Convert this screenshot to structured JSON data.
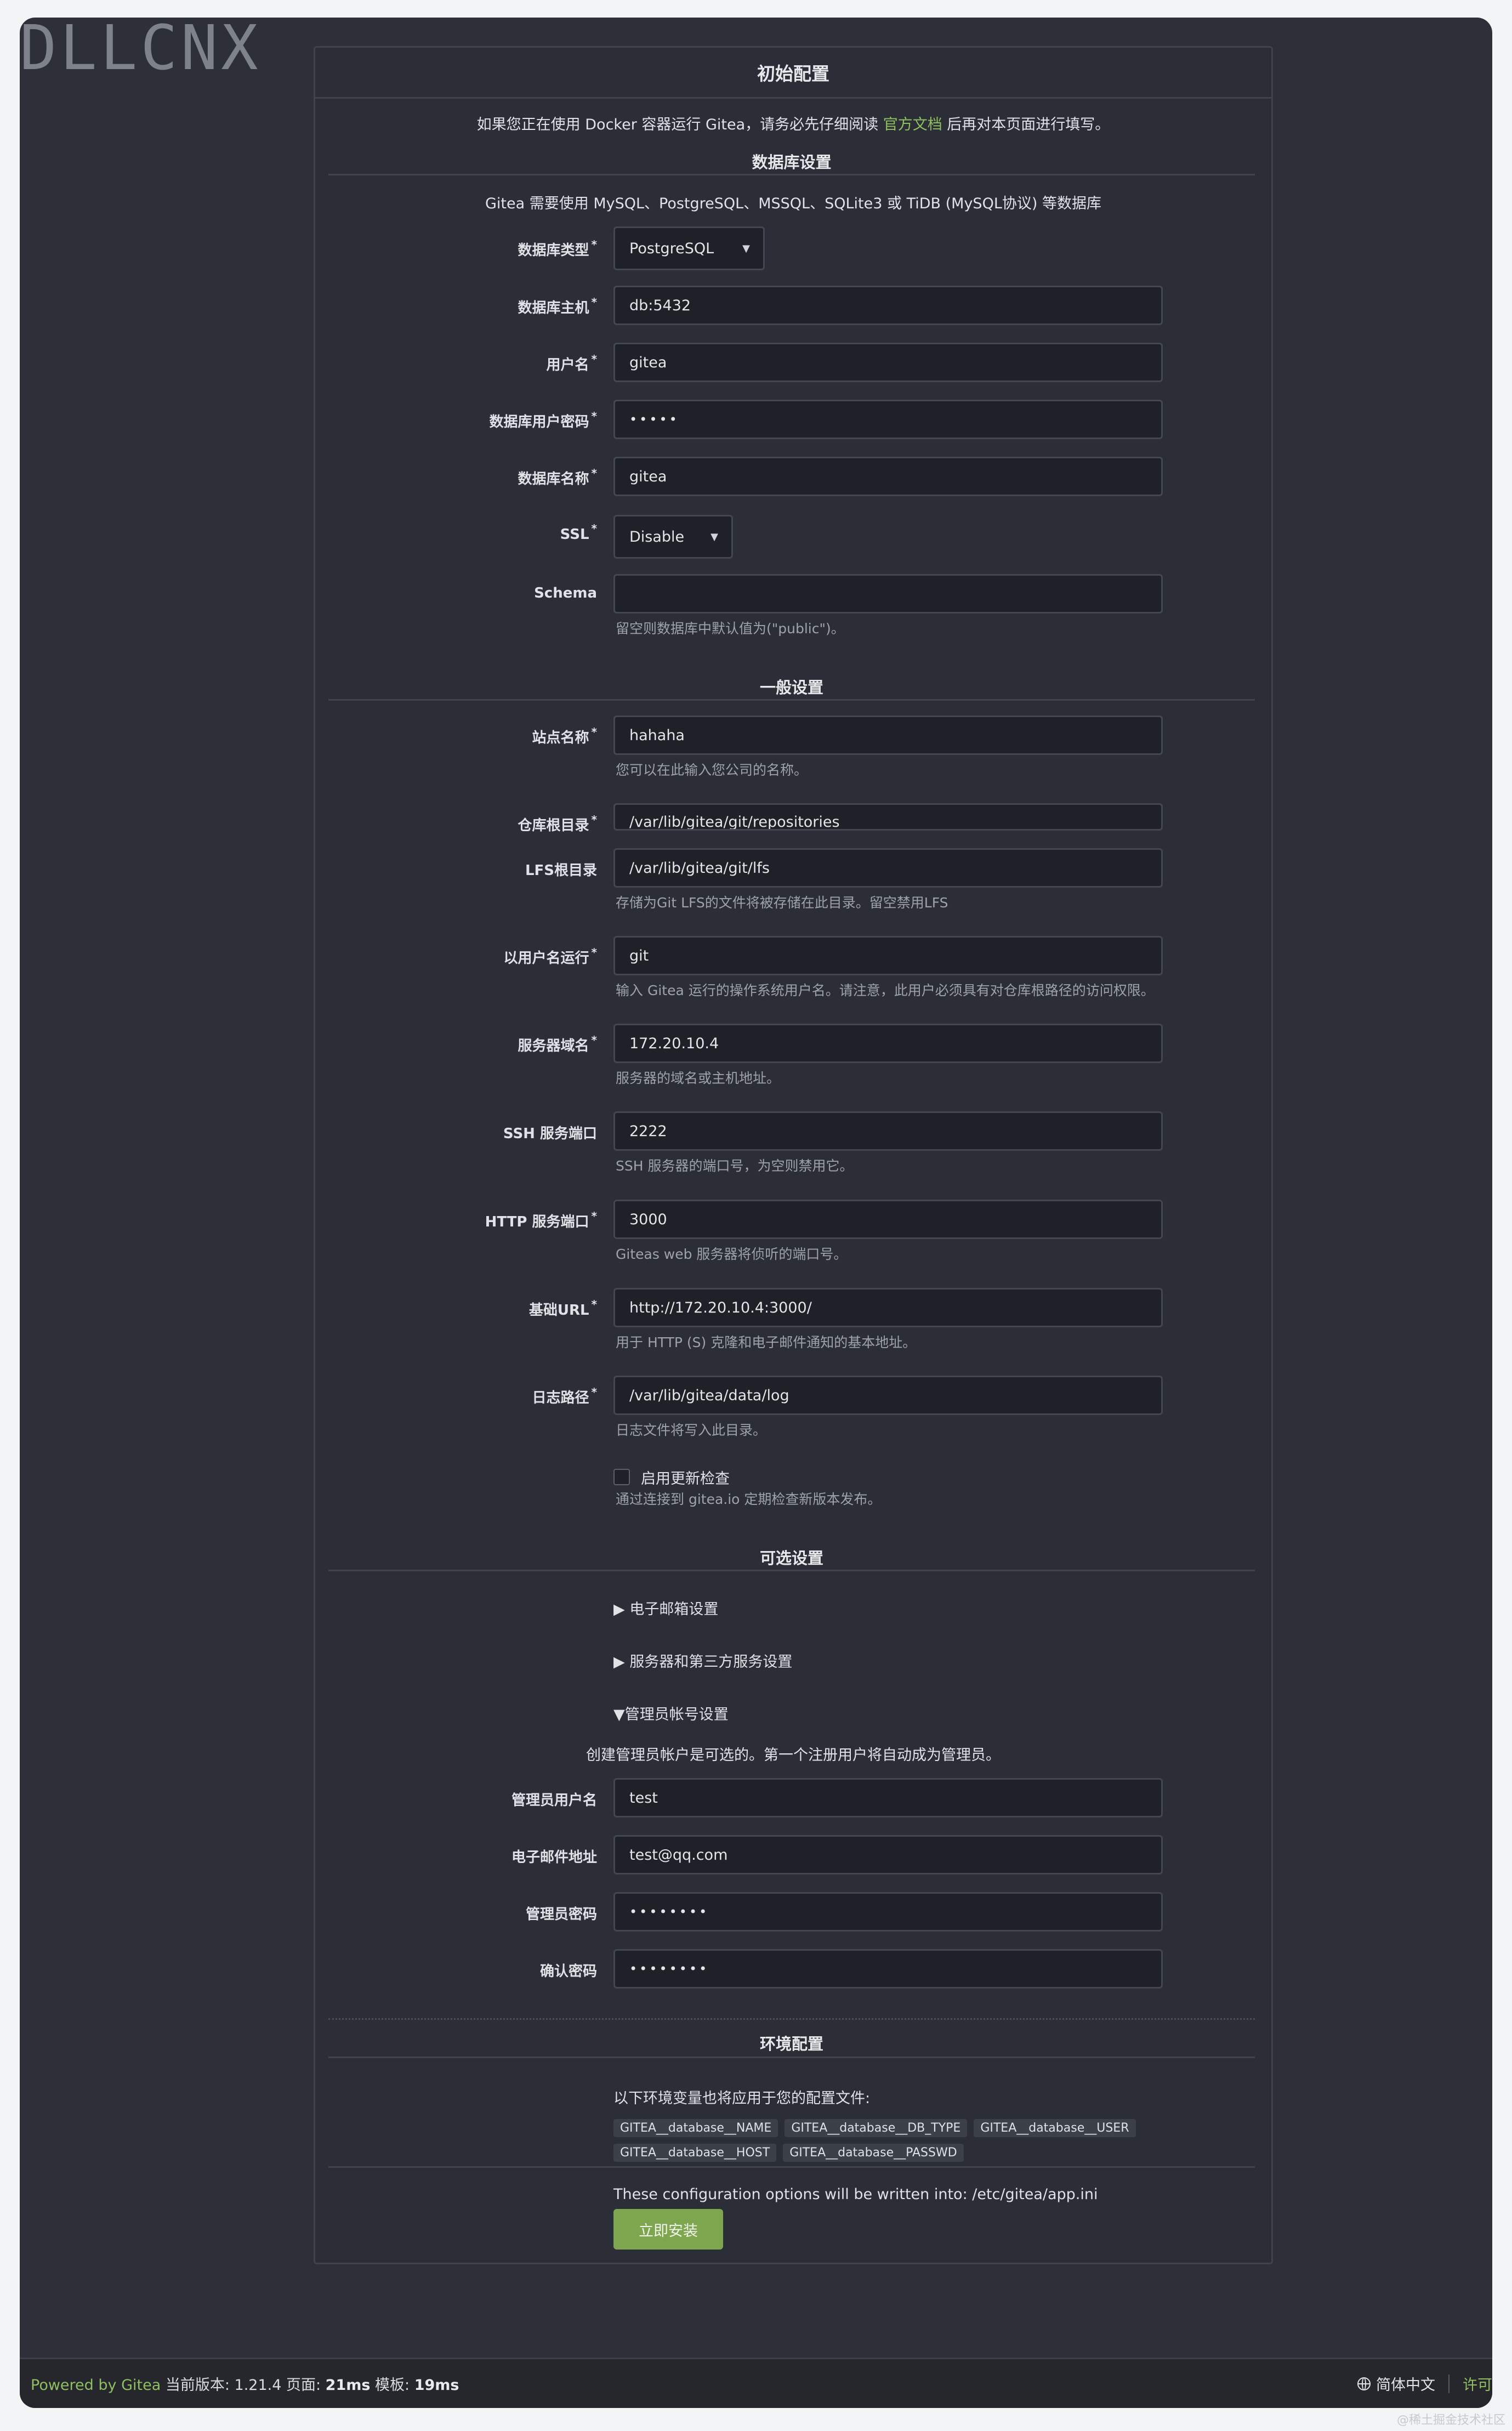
{
  "watermark_top": "DLLCNX",
  "watermark_bottom": "@稀土掘金技术社区",
  "title": "初始配置",
  "docker_notice": {
    "before": "如果您正在使用 Docker 容器运行 Gitea，请务必先仔细阅读 ",
    "link": "官方文档",
    "after": " 后再对本页面进行填写。"
  },
  "database": {
    "section_title": "数据库设置",
    "note": "Gitea 需要使用 MySQL、PostgreSQL、MSSQL、SQLite3 或 TiDB (MySQL协议) 等数据库",
    "type_label": "数据库类型",
    "type_value": "PostgreSQL",
    "host_label": "数据库主机",
    "host_value": "db:5432",
    "user_label": "用户名",
    "user_value": "gitea",
    "password_label": "数据库用户密码",
    "password_value": "•••••",
    "name_label": "数据库名称",
    "name_value": "gitea",
    "ssl_label": "SSL",
    "ssl_value": "Disable",
    "schema_label": "Schema",
    "schema_value": "",
    "schema_help": "留空则数据库中默认值为(\"public\")。"
  },
  "general": {
    "section_title": "一般设置",
    "site_label": "站点名称",
    "site_value": "hahaha",
    "site_help": "您可以在此输入您公司的名称。",
    "repo_label": "仓库根目录",
    "repo_value": "/var/lib/gitea/git/repositories",
    "lfs_label": "LFS根目录",
    "lfs_value": "/var/lib/gitea/git/lfs",
    "lfs_help": "存储为Git LFS的文件将被存储在此目录。留空禁用LFS",
    "runuser_label": "以用户名运行",
    "runuser_value": "git",
    "runuser_help": "输入 Gitea 运行的操作系统用户名。请注意，此用户必须具有对仓库根路径的访问权限。",
    "domain_label": "服务器域名",
    "domain_value": "172.20.10.4",
    "domain_help": "服务器的域名或主机地址。",
    "ssh_label": "SSH 服务端口",
    "ssh_value": "2222",
    "ssh_help": "SSH 服务器的端口号，为空则禁用它。",
    "http_label": "HTTP 服务端口",
    "http_value": "3000",
    "http_help": "Giteas web 服务器将侦听的端口号。",
    "url_label": "基础URL",
    "url_value": "http://172.20.10.4:3000/",
    "url_help": "用于 HTTP (S) 克隆和电子邮件通知的基本地址。",
    "log_label": "日志路径",
    "log_value": "/var/lib/gitea/data/log",
    "log_help": "日志文件将写入此目录。",
    "update_label": "启用更新检查",
    "update_help": "通过连接到 gitea.io 定期检查新版本发布。"
  },
  "optional": {
    "section_title": "可选设置",
    "email_summary": "▶ 电子邮箱设置",
    "server_summary": "▶ 服务器和第三方服务设置",
    "admin_summary": "▼管理员帐号设置",
    "admin_note": "创建管理员帐户是可选的。第一个注册用户将自动成为管理员。",
    "admin_user_label": "管理员用户名",
    "admin_user_value": "test",
    "admin_email_label": "电子邮件地址",
    "admin_email_value": "test@qq.com",
    "admin_pass_label": "管理员密码",
    "admin_pass_value": "••••••••",
    "admin_confirm_label": "确认密码",
    "admin_confirm_value": "••••••••"
  },
  "env": {
    "section_title": "环境配置",
    "intro": "以下环境变量也将应用于您的配置文件:",
    "tags": [
      "GITEA__database__NAME",
      "GITEA__database__DB_TYPE",
      "GITEA__database__USER",
      "GITEA__database__HOST",
      "GITEA__database__PASSWD"
    ]
  },
  "config_note": "These configuration options will be written into: /etc/gitea/app.ini",
  "install_button": "立即安装",
  "footer": {
    "powered": "Powered by Gitea",
    "version_label": " 当前版本: ",
    "version": "1.21.4",
    "page_label": " 页面: ",
    "page_time": "21ms",
    "template_label": " 模板: ",
    "template_time": "19ms",
    "language": "简体中文",
    "license": "许可"
  }
}
